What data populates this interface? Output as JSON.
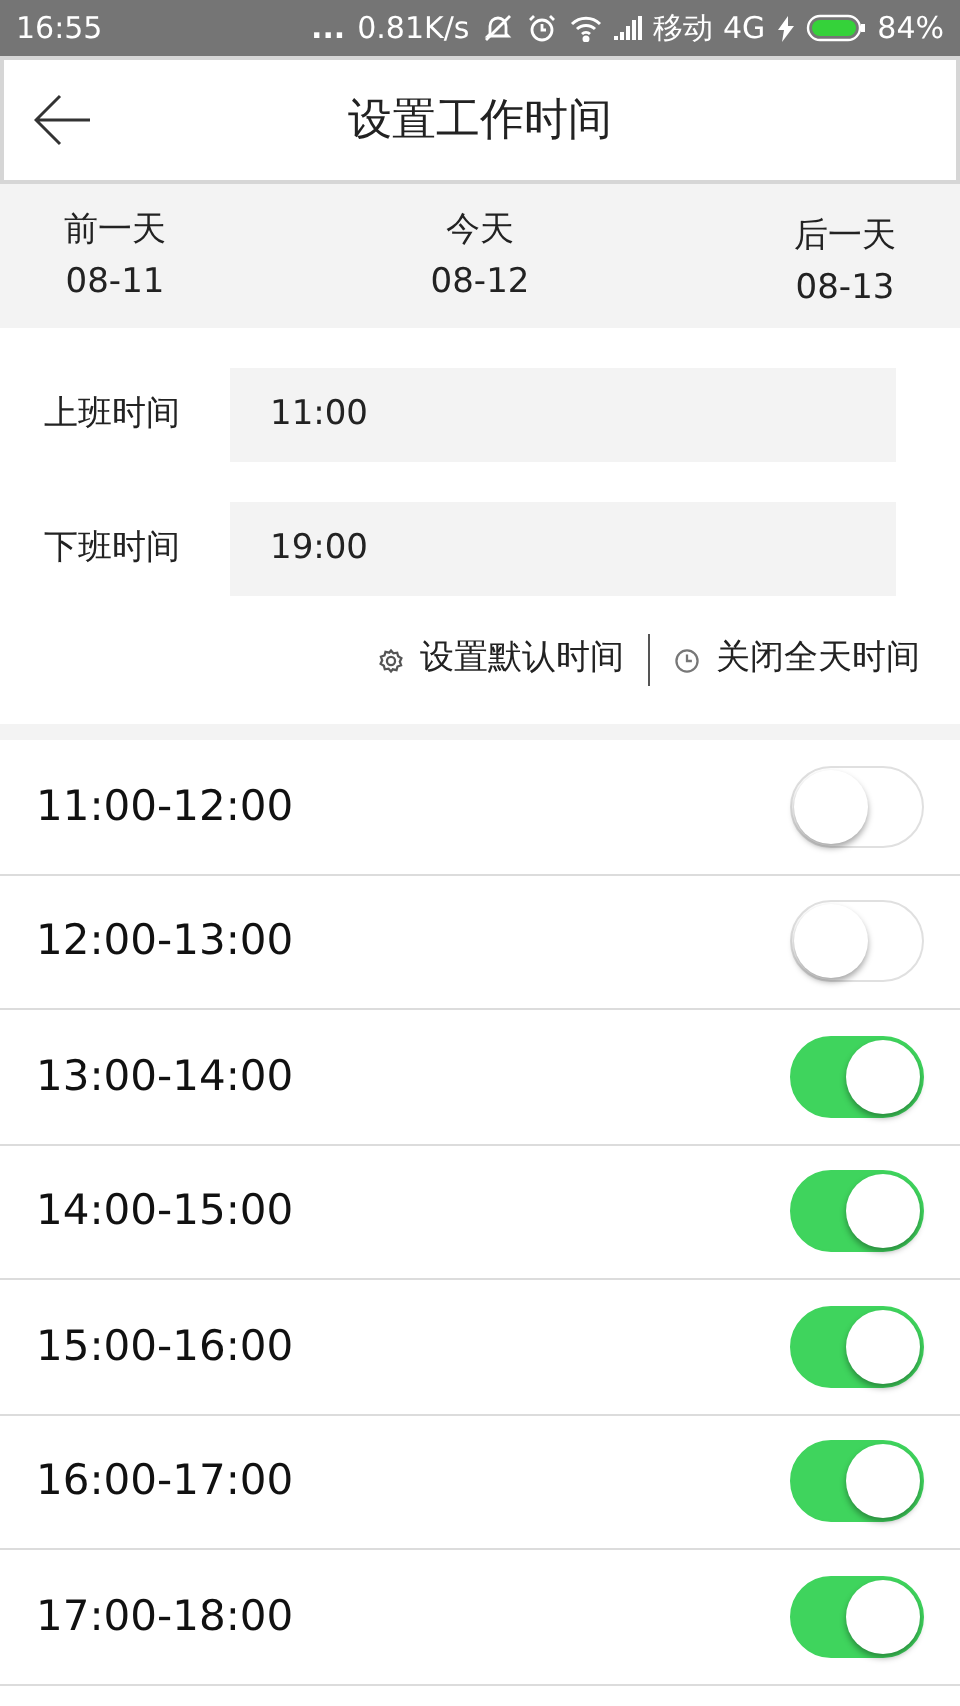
{
  "status_bar": {
    "time": "16:55",
    "dots": "...",
    "speed": "0.81K/s",
    "carrier": "移动 4G",
    "battery": "84%"
  },
  "header": {
    "title": "设置工作时间"
  },
  "days": [
    {
      "label": "前一天",
      "date": "08-11"
    },
    {
      "label": "今天",
      "date": "08-12"
    },
    {
      "label": "后一天",
      "date": "08-13"
    }
  ],
  "fields": [
    {
      "label": "上班时间",
      "value": "11:00"
    },
    {
      "label": "下班时间",
      "value": "19:00"
    }
  ],
  "actions": [
    {
      "kind": "gear",
      "label": "设置默认时间"
    },
    {
      "kind": "clock",
      "label": "关闭全天时间"
    }
  ],
  "slots": [
    {
      "label": "11:00-12:00",
      "on": false
    },
    {
      "label": "12:00-13:00",
      "on": false
    },
    {
      "label": "13:00-14:00",
      "on": true
    },
    {
      "label": "14:00-15:00",
      "on": true
    },
    {
      "label": "15:00-16:00",
      "on": true
    },
    {
      "label": "16:00-17:00",
      "on": true
    },
    {
      "label": "17:00-18:00",
      "on": true
    }
  ]
}
